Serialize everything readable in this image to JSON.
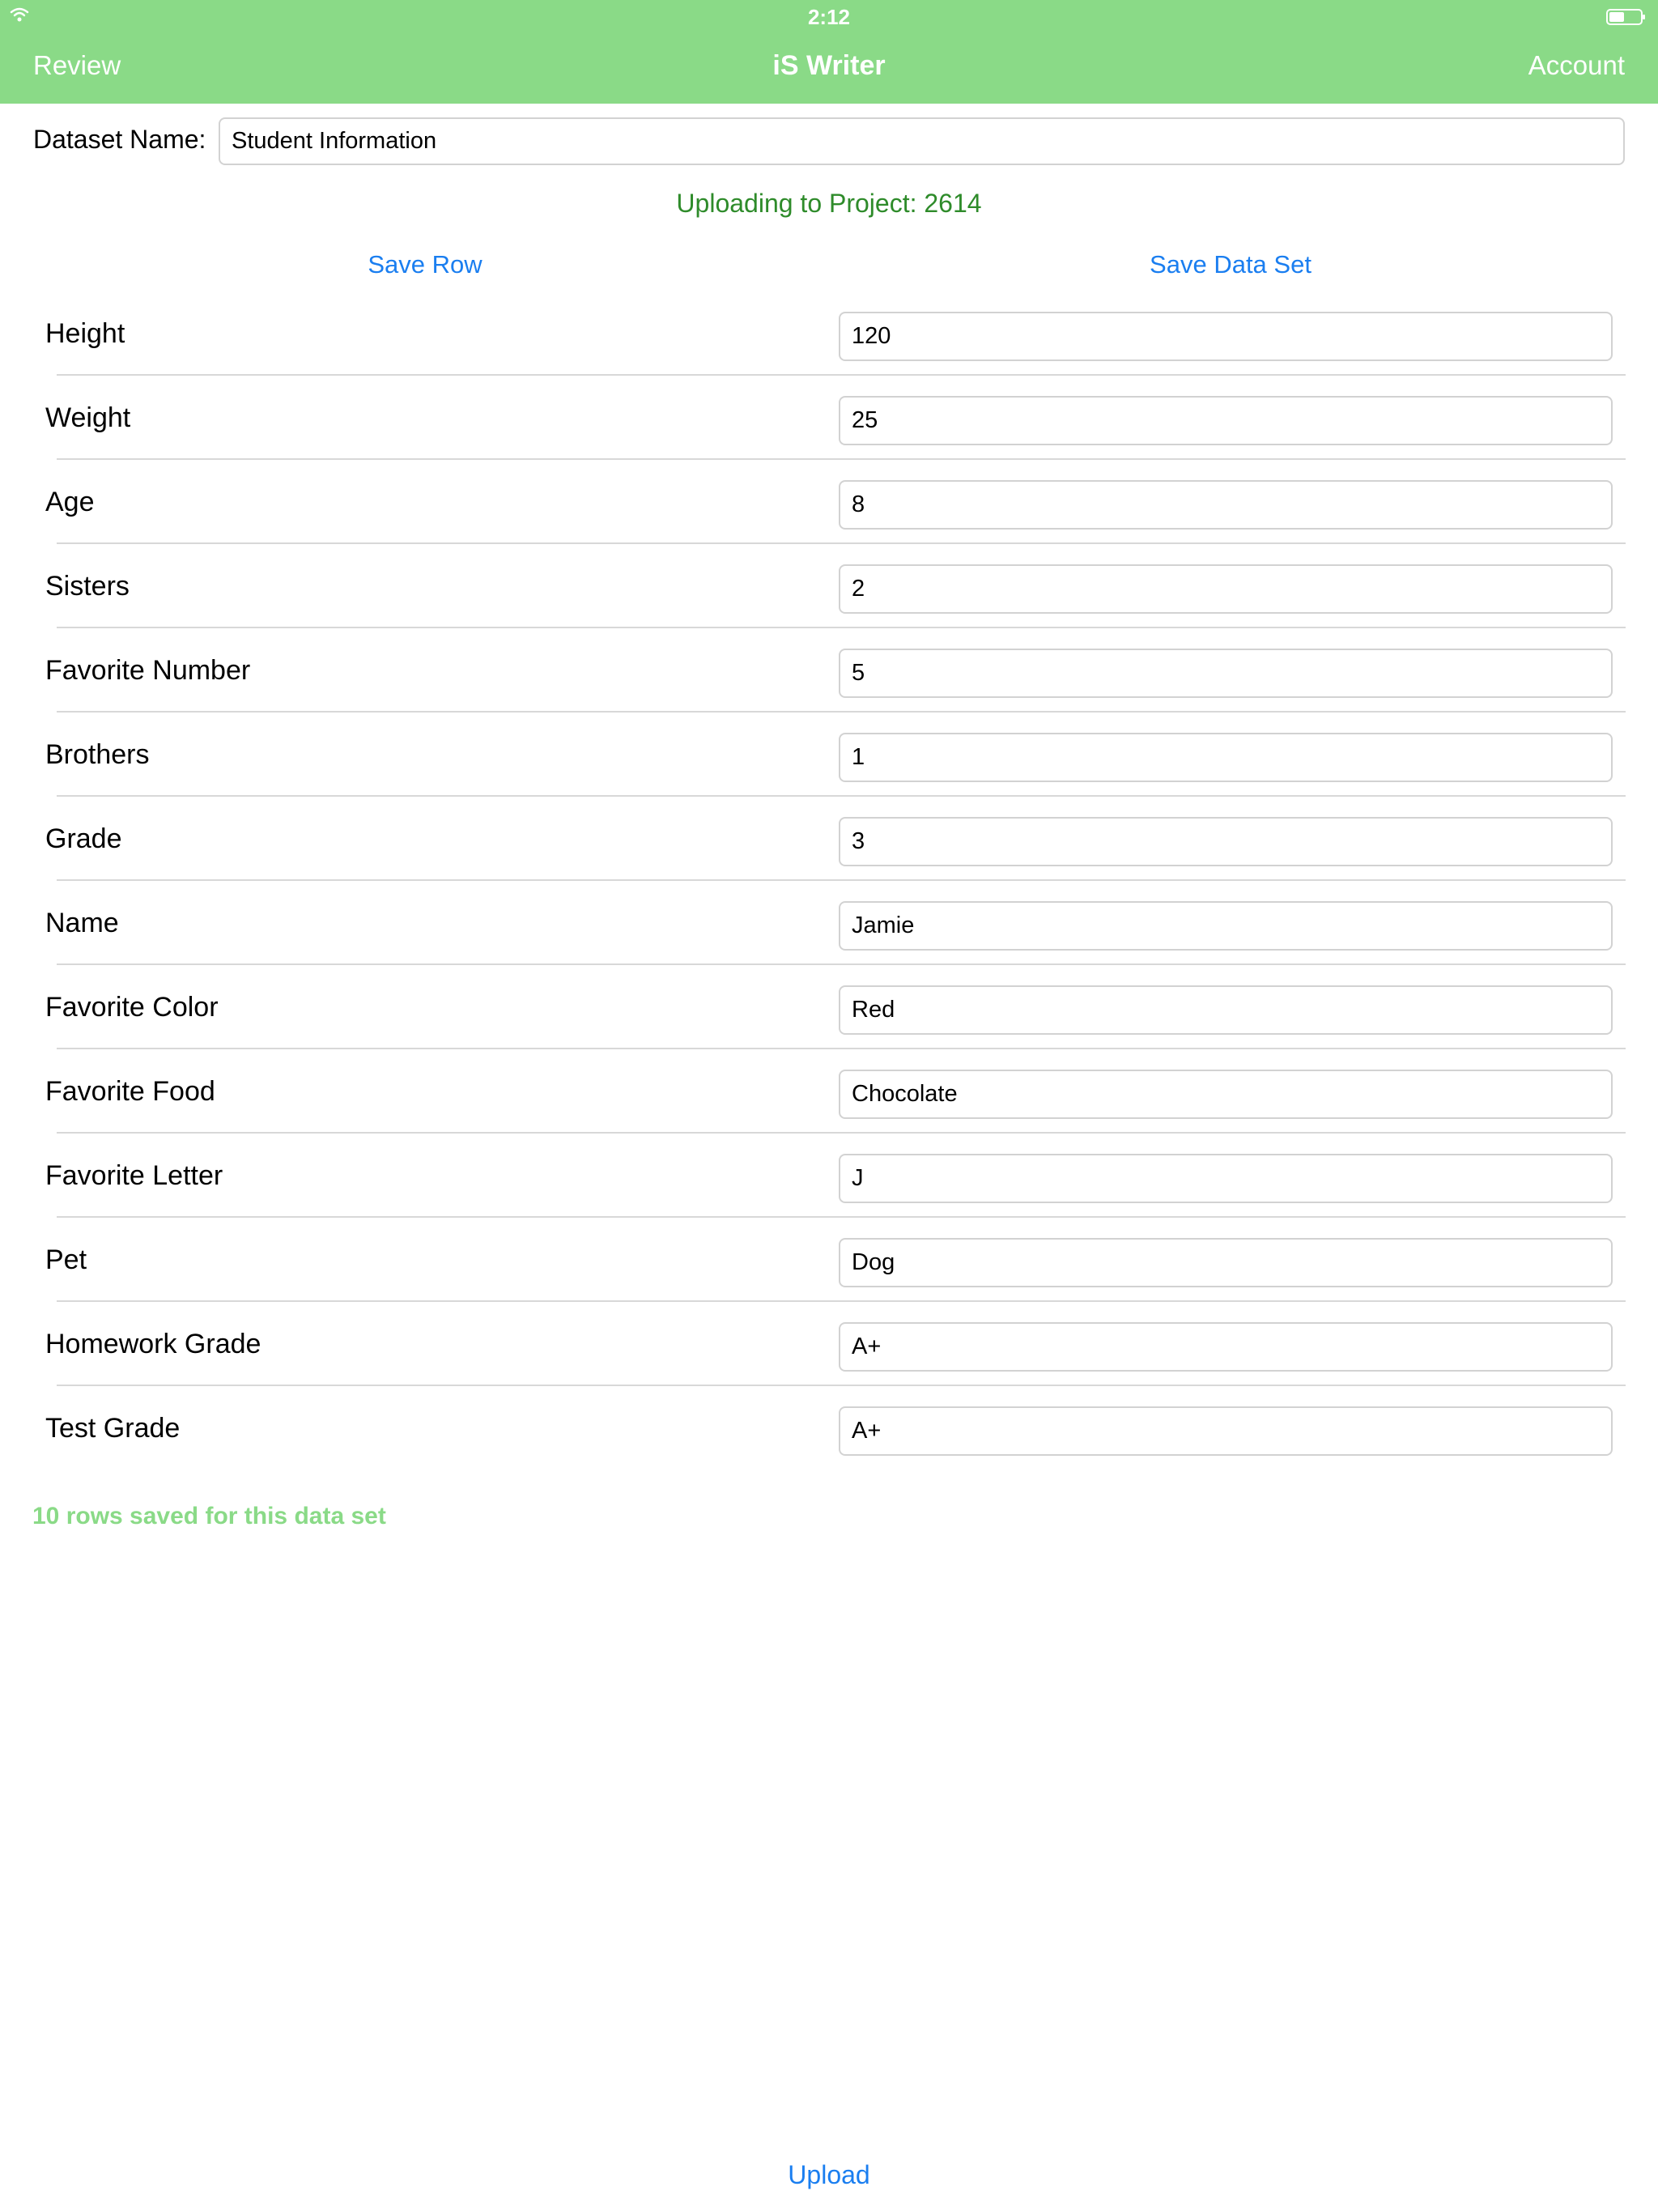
{
  "status_bar": {
    "time": "2:12",
    "wifi_icon": "wifi-icon",
    "battery_icon": "battery-icon"
  },
  "nav": {
    "left_label": "Review",
    "title": "iS Writer",
    "right_label": "Account",
    "bar_color": "#8ada87"
  },
  "dataset": {
    "label": "Dataset Name:",
    "value": "Student Information"
  },
  "project_status": "Uploading to Project: 2614",
  "actions": {
    "save_row": "Save Row",
    "save_data_set": "Save Data Set",
    "upload": "Upload"
  },
  "fields": [
    {
      "label": "Height",
      "value": "120"
    },
    {
      "label": "Weight",
      "value": "25"
    },
    {
      "label": "Age",
      "value": "8"
    },
    {
      "label": "Sisters",
      "value": "2"
    },
    {
      "label": "Favorite Number",
      "value": "5"
    },
    {
      "label": "Brothers",
      "value": "1"
    },
    {
      "label": "Grade",
      "value": "3"
    },
    {
      "label": "Name",
      "value": "Jamie"
    },
    {
      "label": "Favorite Color",
      "value": "Red"
    },
    {
      "label": "Favorite Food",
      "value": "Chocolate"
    },
    {
      "label": "Favorite Letter",
      "value": "J"
    },
    {
      "label": "Pet",
      "value": "Dog"
    },
    {
      "label": "Homework Grade",
      "value": "A+"
    },
    {
      "label": "Test Grade",
      "value": "A+"
    }
  ],
  "rows_saved_text": "10 rows saved for this data set",
  "colors": {
    "accent_green": "#8ada87",
    "status_green": "#2e8b2a",
    "link_blue": "#1a7ef0"
  }
}
